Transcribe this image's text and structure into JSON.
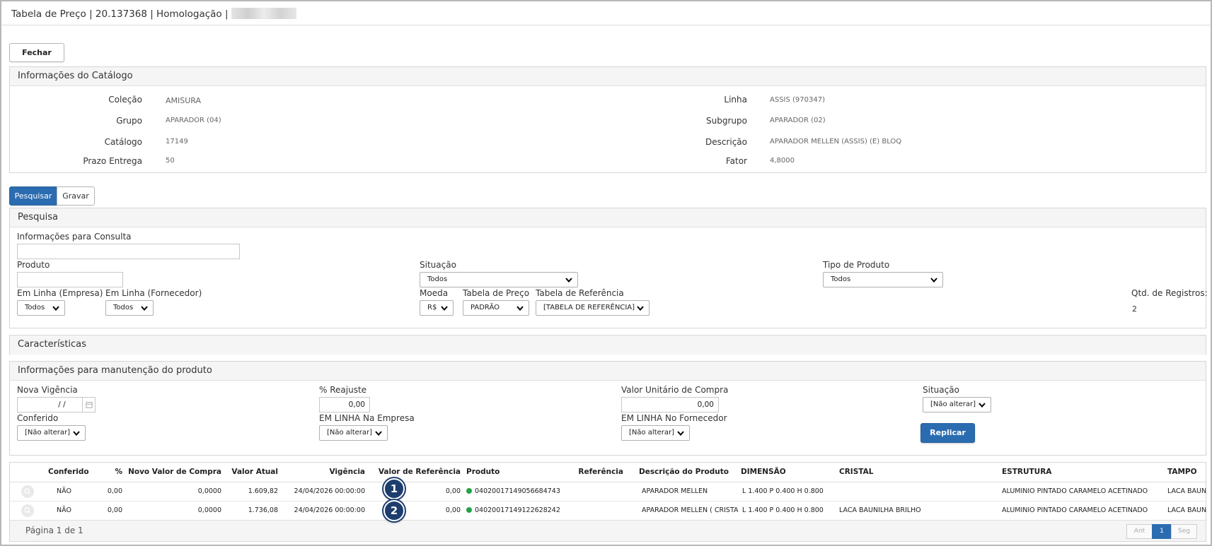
{
  "window": {
    "title": "Tabela de Preço | 20.137368 | Homologação |"
  },
  "actions": {
    "fechar": "Fechar"
  },
  "catalog": {
    "heading": "Informações do Catálogo",
    "colecao_label": "Coleção",
    "colecao_value": "AMISURA",
    "grupo_label": "Grupo",
    "grupo_value": "APARADOR (04)",
    "catalogo_label": "Catálogo",
    "catalogo_value": "17149",
    "prazo_label": "Prazo Entrega",
    "prazo_value": "50",
    "linha_label": "Linha",
    "linha_value": "ASSIS (970347)",
    "subgrupo_label": "Subgrupo",
    "subgrupo_value": "APARADOR (02)",
    "descricao_label": "Descrição",
    "descricao_value": "APARADOR MELLEN (ASSIS) (E) BLOQ",
    "fator_label": "Fator",
    "fator_value": "4,8000"
  },
  "tabs": {
    "pesquisar": "Pesquisar",
    "gravar": "Gravar"
  },
  "search": {
    "heading": "Pesquisa",
    "info_consulta_label": "Informações para Consulta",
    "info_consulta_value": "",
    "produto_label": "Produto",
    "produto_value": "",
    "situacao_label": "Situação",
    "situacao_value": "Todos",
    "tipo_produto_label": "Tipo de Produto",
    "tipo_produto_value": "Todos",
    "em_linha_empresa_label": "Em Linha (Empresa)",
    "em_linha_empresa_value": "Todos",
    "em_linha_fornecedor_label": "Em Linha (Fornecedor)",
    "em_linha_fornecedor_value": "Todos",
    "moeda_label": "Moeda",
    "moeda_value": "R$",
    "tabela_preco_label": "Tabela de Preço",
    "tabela_preco_value": "PADRÃO",
    "tabela_referencia_label": "Tabela de Referência",
    "tabela_referencia_value": "[TABELA DE REFERÊNCIA]",
    "qtd_registros_label": "Qtd. de Registros:",
    "qtd_registros_value": "2"
  },
  "caracteristicas": {
    "heading": "Características"
  },
  "maintenance": {
    "heading": "Informações para manutenção do produto",
    "nova_vigencia_label": "Nova Vigência",
    "nova_vigencia_value": "/  /",
    "reajuste_label": "% Reajuste",
    "reajuste_value": "0,00",
    "valor_unitario_label": "Valor Unitário de Compra",
    "valor_unitario_value": "0,00",
    "situacao_label": "Situação",
    "situacao_value": "[Não alterar]",
    "conferido_label": "Conferido",
    "conferido_value": "[Não alterar]",
    "em_linha_empresa_label": "EM LINHA Na Empresa",
    "em_linha_empresa_value": "[Não alterar]",
    "em_linha_fornecedor_label": "EM LINHA No Fornecedor",
    "em_linha_fornecedor_value": "[Não alterar]",
    "replicar": "Replicar"
  },
  "grid": {
    "headers": [
      "Conferido",
      "%",
      "Novo Valor de Compra",
      "Valor Atual",
      "Vigência",
      "Valor de Referência",
      "Produto",
      "Referência",
      "Descrição do Produto",
      "DIMENSÃO",
      "CRISTAL",
      "ESTRUTURA",
      "TAMPO"
    ],
    "rows": [
      {
        "conferido": "NÃO",
        "pct": "0,00",
        "novo_valor": "0,0000",
        "valor_atual": "1.609,82",
        "vigencia": "24/04/2026 00:00:00",
        "valor_ref": "0,00",
        "produto": "04020017149056684743",
        "referencia": "",
        "descricao": "APARADOR MELLEN",
        "dimensao": "L 1.400 P 0.400 H 0.800",
        "cristal": "",
        "estrutura": "ALUMINIO PINTADO CARAMELO ACETINADO",
        "tampo": "LACA BAUNILHA BRILHO"
      },
      {
        "conferido": "NÃO",
        "pct": "0,00",
        "novo_valor": "0,0000",
        "valor_atual": "1.736,08",
        "vigencia": "24/04/2026 00:00:00",
        "valor_ref": "0,00",
        "produto": "04020017149122628242",
        "referencia": "",
        "descricao": "APARADOR MELLEN ( CRISTAL )",
        "dimensao": "L 1.400 P 0.400 H 0.800",
        "cristal": "LACA BAUNILHA BRILHO",
        "estrutura": "ALUMINIO PINTADO CARAMELO ACETINADO",
        "tampo": "LACA BAUNILHA BRILHO"
      }
    ],
    "callouts": [
      "1",
      "2"
    ],
    "status_color": "#22a447"
  },
  "pagination": {
    "info": "Página 1 de 1",
    "prev": "Ant",
    "current": "1",
    "next": "Seg"
  },
  "colors": {
    "accent": "#2b6cb0",
    "callout": "#1d3d6e"
  },
  "icons": {
    "calendar": "calendar-icon",
    "chevron": "chevron-down-icon",
    "search": "magnifier-icon",
    "status": "status-dot-icon"
  }
}
